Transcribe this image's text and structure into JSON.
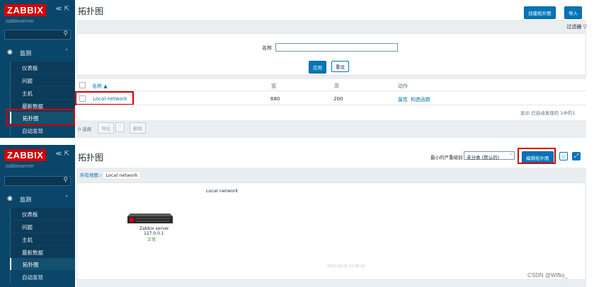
{
  "app": {
    "logo_text": "ZABBIX",
    "collapse_icons": "≪ ⇱",
    "server_name": "zabbixserver"
  },
  "sidebar": {
    "section_label": "监测",
    "items": [
      {
        "label": "仪表板"
      },
      {
        "label": "问题"
      },
      {
        "label": "主机"
      },
      {
        "label": "最新数据"
      },
      {
        "label": "拓扑图"
      },
      {
        "label": "自动发现"
      }
    ]
  },
  "top": {
    "title": "拓扑图",
    "create_button": "创建拓扑图",
    "import_button": "导入",
    "filter_tab": "过滤器",
    "filter_name_label": "名称",
    "filter_name_value": "",
    "apply_button": "应用",
    "reset_button": "重设",
    "table": {
      "headers": [
        "名称 ▲",
        "宽",
        "高",
        "动作"
      ],
      "rows": [
        {
          "name": "Local network",
          "width": "680",
          "height": "200",
          "action1": "属性",
          "action2": "构造函数"
        }
      ],
      "summary": "显示 已自动发现的 1中的1"
    },
    "footer": {
      "selected": "0 选择",
      "export_button": "导出",
      "delete_button": "删除"
    }
  },
  "bottom": {
    "title": "拓扑图",
    "severity_label": "最小的严重级别",
    "severity_value": "未分类 (默认的)",
    "edit_button": "编辑拓扑图",
    "breadcrumb_all": "所有地图",
    "breadcrumb_separator": "/",
    "breadcrumb_current": "Local network",
    "map_title": "Local network",
    "host_name": "Zabbix server",
    "host_ip": "127.0.0.1",
    "host_status": "正常",
    "map_timestamp": "2022-03-21 11:28:14"
  },
  "watermark": "CSDN @Wlfks_",
  "colors": {
    "sidebar": "#0a466a",
    "accent": "#0275b8",
    "highlight": "#d40000",
    "status_ok": "#3a9a3a"
  },
  "icons": [
    "search-icon",
    "eye-icon",
    "chevron-up-icon",
    "filter-icon",
    "star-icon",
    "fullscreen-icon",
    "server-icon"
  ]
}
